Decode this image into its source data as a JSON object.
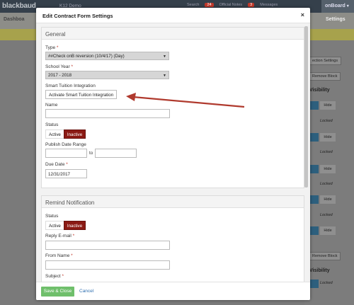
{
  "background": {
    "logo": "blackbaud",
    "school": "K12 Demo",
    "topbar_items": [
      {
        "badge": "",
        "label": "Search"
      },
      {
        "badge": "24",
        "label": "Official Notes"
      },
      {
        "badge": "3",
        "label": "Messages"
      }
    ],
    "onboard": "onBoard",
    "dashboard": "Dashboa",
    "settings": "Settings",
    "section_settings": "ection Settings",
    "remove_block": "Remove Block",
    "visibility": "Visibility",
    "show_label": "",
    "hide_label": "Hide",
    "locked_label": "Locked"
  },
  "modal": {
    "title": "Edit Contract Form Settings",
    "close": "×",
    "general": {
      "heading": "General",
      "type_label": "Type",
      "type_value": "##Check onB reversion (10/4/17) (Day)",
      "school_year_label": "School Year",
      "school_year_value": "2017 - 2018",
      "smart_tuition_label": "Smart Tuition Integration",
      "smart_tuition_button": "Activate Smart Tuition Integration",
      "name_label": "Name",
      "name_value": "",
      "status_label": "Status",
      "status_active": "Active",
      "status_inactive": "Inactive",
      "publish_label": "Publish Date Range",
      "publish_from": "",
      "publish_to_text": "to",
      "publish_to": "",
      "due_label": "Due Date",
      "due_value": "12/31/2017"
    },
    "remind": {
      "heading": "Remind Notification",
      "status_label": "Status",
      "status_active": "Active",
      "status_inactive": "Inactive",
      "reply_label": "Reply E-mail",
      "reply_value": "",
      "from_label": "From Name",
      "from_value": "",
      "subject_label": "Subject"
    },
    "footer": {
      "save": "Save & Close",
      "cancel": "Cancel"
    },
    "required_mark": "*"
  },
  "colors": {
    "inactive_active_toggle": "#8b1a14",
    "save_button": "#6fbf6b",
    "arrow": "#b03a2e",
    "link": "#2f6fb0"
  }
}
